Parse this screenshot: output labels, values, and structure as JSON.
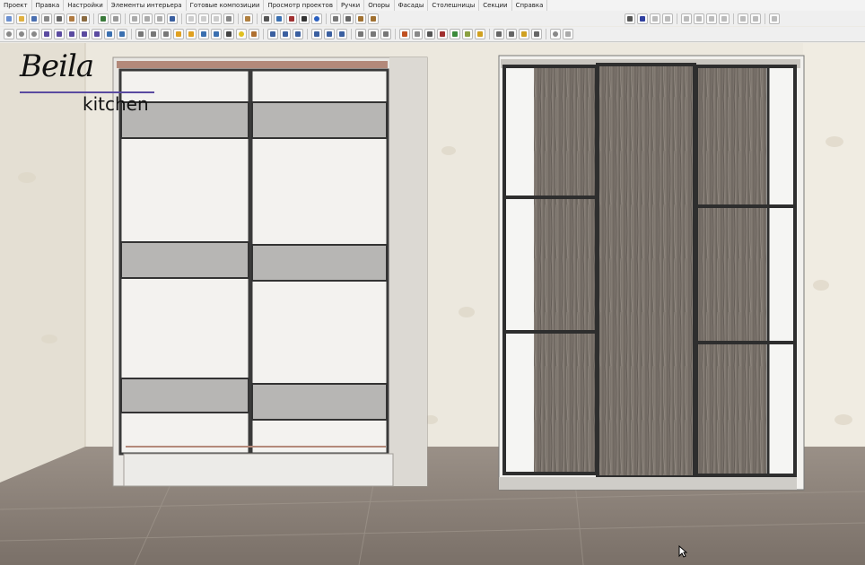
{
  "menu": [
    "Проект",
    "Правка",
    "Настройки",
    "Элементы интерьера",
    "Готовые композиции",
    "Просмотр проектов",
    "Ручки",
    "Опоры",
    "Фасады",
    "Столешницы",
    "Секции",
    "Справка"
  ],
  "logo": {
    "script": "Beila",
    "sub": "kitchen"
  },
  "colors": {
    "accent": "#5a4aa0",
    "wall": "#ece8de",
    "floor": "#8a7f76",
    "wood": "#6f6860",
    "frame": "#2e2e2e"
  }
}
